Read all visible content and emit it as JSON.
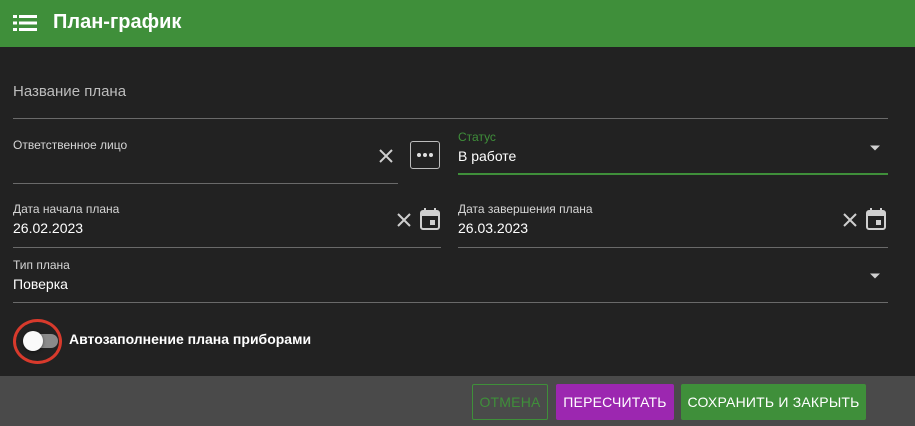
{
  "header": {
    "title": "План-график",
    "menu_icon": "list-menu-icon"
  },
  "form": {
    "plan_name_placeholder": "Название плана",
    "responsible": {
      "label": "Ответственное лицо",
      "value": ""
    },
    "status": {
      "label": "Статус",
      "value": "В работе"
    },
    "start_date": {
      "label": "Дата начала плана",
      "value": "26.02.2023"
    },
    "end_date": {
      "label": "Дата завершения плана",
      "value": "26.03.2023"
    },
    "plan_type": {
      "label": "Тип плана",
      "value": "Поверка"
    },
    "autofill": {
      "label": "Автозаполнение плана приборами",
      "enabled": false
    }
  },
  "footer": {
    "cancel_label": "ОТМЕНА",
    "recalculate_label": "ПЕРЕСЧИТАТЬ",
    "save_close_label": "СОХРАНИТЬ И ЗАКРЫТЬ"
  },
  "colors": {
    "header_bg": "#3f8f3a",
    "accent_green": "#3f8f3a",
    "recalc_purple": "#9c27b0",
    "highlight_red": "#d83a2c",
    "background": "#222222"
  }
}
